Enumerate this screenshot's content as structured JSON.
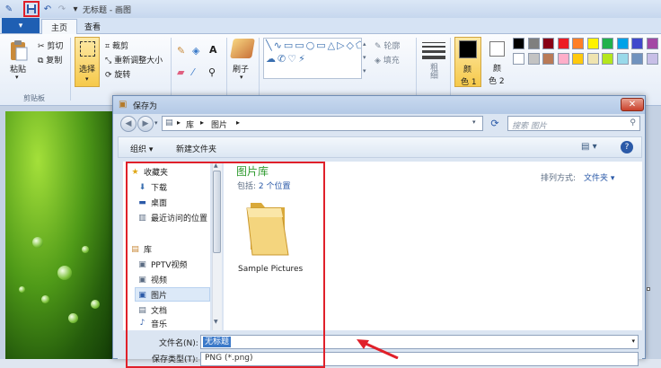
{
  "window": {
    "title": "无标题 - 画图"
  },
  "tabs": {
    "file": "▾",
    "home": "主页",
    "view": "查看"
  },
  "ribbon": {
    "clipboard": {
      "paste": "粘贴",
      "cut": "剪切",
      "copy": "复制",
      "group": "剪贴板"
    },
    "image": {
      "select": "选择",
      "crop": "裁剪",
      "resize": "重新调整大小",
      "rotate": "旋转"
    },
    "tools": {
      "text_glyph": "A"
    },
    "brushes": {
      "label": "刷子"
    },
    "shapes": {
      "outline": "轮廓",
      "fill": "填充"
    },
    "size": {
      "label": "粗细"
    },
    "color1": {
      "label_a": "颜",
      "label_b": "色 1"
    },
    "color2": {
      "label_a": "颜",
      "label_b": "色 2"
    },
    "palette": [
      "#000000",
      "#7f7f7f",
      "#880015",
      "#ed1c24",
      "#ff7f27",
      "#fff200",
      "#22b14c",
      "#00a2e8",
      "#3f48cc",
      "#a349a4",
      "#ffffff",
      "#c3c3c3",
      "#b97a57",
      "#ffaec9",
      "#ffc90e",
      "#efe4b0",
      "#b5e61d",
      "#99d9ea",
      "#7092be",
      "#c8bfe7"
    ]
  },
  "dialog": {
    "title": "保存为",
    "close": "✕",
    "breadcrumb": [
      "库",
      "图片"
    ],
    "search_placeholder": "搜索 图片",
    "organize": "组织 ▾",
    "new_folder": "新建文件夹",
    "nav": {
      "favorites": "收藏夹",
      "downloads": "下载",
      "desktop": "桌面",
      "recent": "最近访问的位置",
      "libraries": "库",
      "pptv": "PPTV视频",
      "videos": "视频",
      "pictures": "图片",
      "documents": "文档",
      "music": "音乐"
    },
    "library_title": "图片库",
    "includes_label": "包括:",
    "includes_link": "2 个位置",
    "arrange_label": "排列方式:",
    "arrange_value": "文件夹 ▾",
    "folder_name": "Sample Pictures",
    "filename_label": "文件名(N):",
    "filename_value": "无标题",
    "filetype_label": "保存类型(T):",
    "filetype_value": "PNG (*.png)"
  },
  "colors": {
    "accent": "#1f5fb3",
    "annotation": "#e0202a",
    "library_title": "#2e9a2e"
  }
}
